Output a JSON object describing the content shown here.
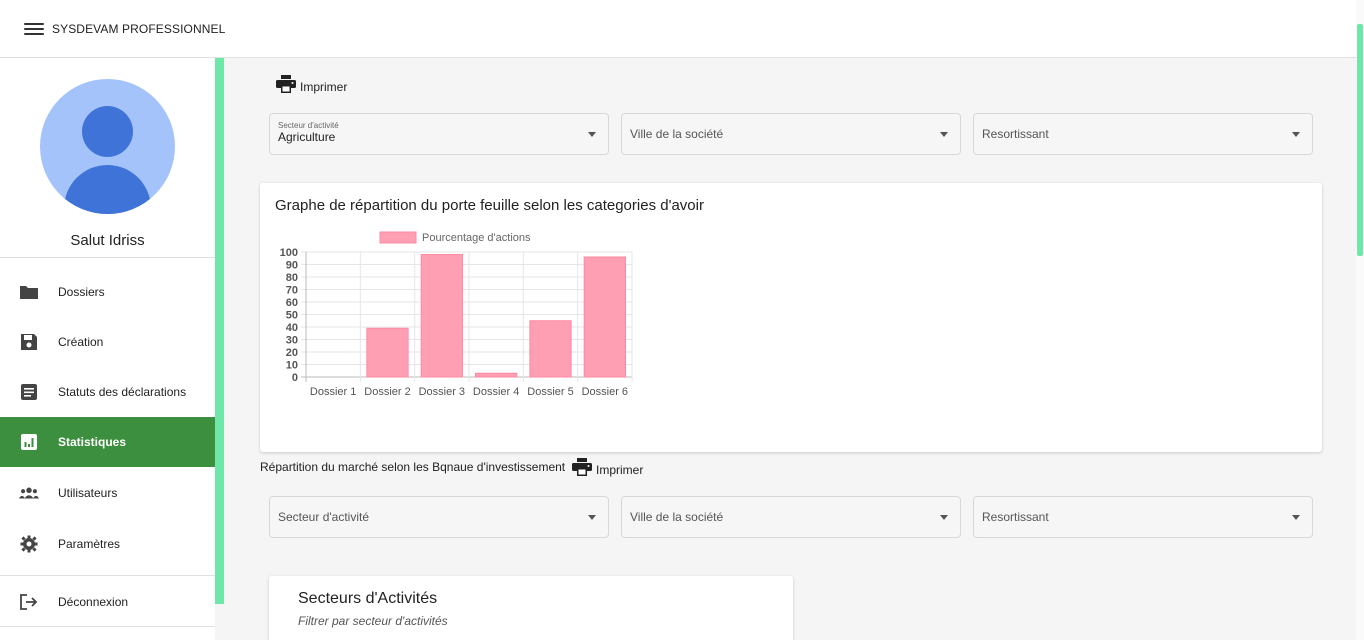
{
  "app": {
    "title": "SYSDEVAM PROFESSIONNEL"
  },
  "user": {
    "greeting": "Salut Idriss"
  },
  "sidebar": {
    "items": [
      {
        "label": "Dossiers",
        "icon": "folder-icon"
      },
      {
        "label": "Création",
        "icon": "save-icon"
      },
      {
        "label": "Statuts des déclarations",
        "icon": "document-icon"
      },
      {
        "label": "Statistiques",
        "icon": "chart-icon",
        "active": true
      },
      {
        "label": "Utilisateurs",
        "icon": "users-icon"
      },
      {
        "label": "Paramètres",
        "icon": "gear-icon"
      },
      {
        "label": "Déconnexion",
        "icon": "logout-icon"
      }
    ]
  },
  "filters_top": {
    "print_label": "Imprimer",
    "secteur": {
      "label": "Secteur d'activité",
      "value": "Agriculture"
    },
    "ville": {
      "placeholder": "Ville de la société"
    },
    "ressortissant": {
      "placeholder": "Resortissant"
    }
  },
  "chart_card": {
    "title": "Graphe de répartition du porte feuille selon les categories d'avoir"
  },
  "chart_data": {
    "type": "bar",
    "categories": [
      "Dossier 1",
      "Dossier 2",
      "Dossier 3",
      "Dossier 4",
      "Dossier 5",
      "Dossier 6"
    ],
    "series": [
      {
        "name": "Pourcentage d'actions",
        "values": [
          0,
          39,
          98,
          3,
          45,
          96
        ]
      }
    ],
    "ylim": [
      0,
      100
    ],
    "yticks": [
      "100",
      "90",
      "80",
      "70",
      "60",
      "50",
      "40",
      "30",
      "20",
      "10",
      "0"
    ],
    "grid": true,
    "legend_position": "top",
    "colors": {
      "bar_fill": "#ff9fb3",
      "bar_stroke": "#ff8aa3"
    }
  },
  "market_section": {
    "title": "Répartition du marché selon les Bqnaue d'investissement",
    "print_label": "Imprimer",
    "secteur": {
      "placeholder": "Secteur d'activité"
    },
    "ville": {
      "placeholder": "Ville de la société"
    },
    "ressortissant": {
      "placeholder": "Resortissant"
    }
  },
  "secteurs_card": {
    "title": "Secteurs d'Activités",
    "subtitle": "Filtrer par secteur d'activités"
  },
  "colors": {
    "accent": "#6ee7a8",
    "active_nav": "#3b8f3e",
    "avatar_bg": "#a4c3fb",
    "avatar_fg": "#3f73d8"
  }
}
